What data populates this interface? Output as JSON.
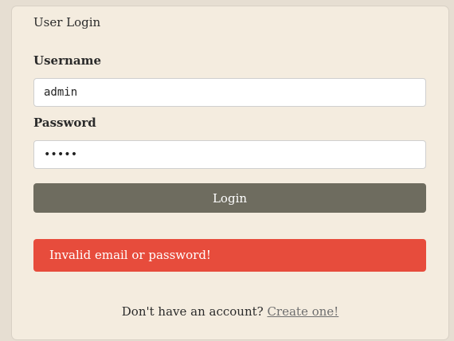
{
  "panel": {
    "title": "User Login"
  },
  "form": {
    "username_label": "Username",
    "username_value": "admin",
    "password_label": "Password",
    "password_value": "•••••",
    "login_button": "Login"
  },
  "error": {
    "message": "Invalid email or password!"
  },
  "footer": {
    "prompt": "Don't have an account? ",
    "link": "Create one!"
  },
  "colors": {
    "background": "#e6ded2",
    "card": "#f4ecdf",
    "button": "#6e6c5f",
    "error": "#e74c3c",
    "link": "#6f6f6f"
  }
}
